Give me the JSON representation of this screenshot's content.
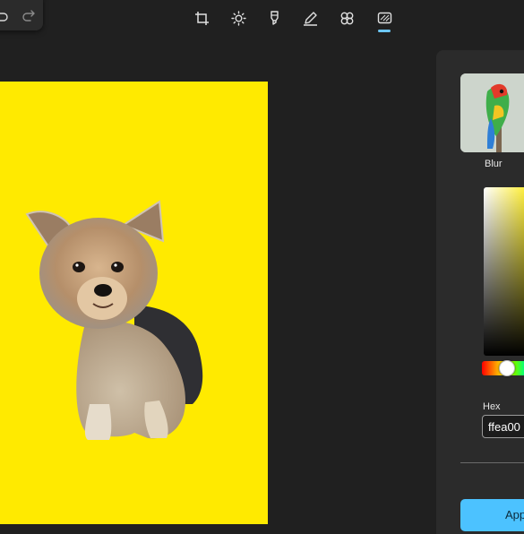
{
  "toolbar": {
    "tools": [
      {
        "name": "crop",
        "icon": "crop-icon"
      },
      {
        "name": "adjust",
        "icon": "brightness-icon"
      },
      {
        "name": "markup",
        "icon": "marker-icon"
      },
      {
        "name": "draw",
        "icon": "pen-icon"
      },
      {
        "name": "filter",
        "icon": "filter-icon"
      },
      {
        "name": "background",
        "icon": "background-icon",
        "active": true
      }
    ],
    "accent": "#6cc6f5"
  },
  "canvas": {
    "background_color": "#ffea00",
    "subject": "dog"
  },
  "panel": {
    "thumbnail_label": "Blur",
    "hex_label": "Hex",
    "hex_value": "ffea00",
    "hue_knob_position": 0.5,
    "apply_label": "Apply",
    "apply_color": "#4cc2ff"
  }
}
